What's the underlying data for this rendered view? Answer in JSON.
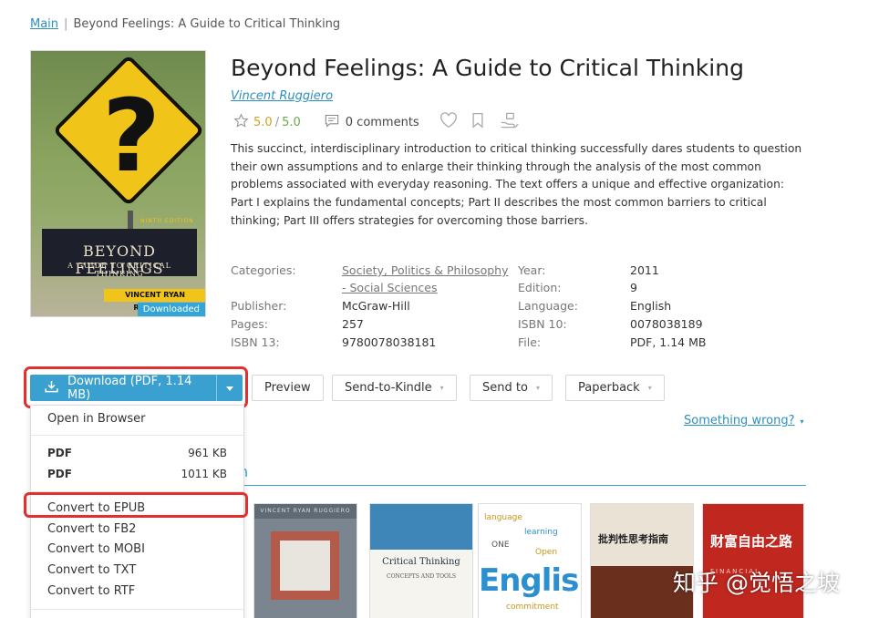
{
  "breadcrumb": {
    "home": "Main",
    "separator": "|",
    "current": "Beyond Feelings: A Guide to Critical Thinking"
  },
  "book": {
    "title": "Beyond Feelings: A Guide to Critical Thinking",
    "author": "Vincent Ruggiero",
    "rating": "5.0",
    "rating_separator": "/",
    "rating_max": "5.0",
    "comments": "0 comments",
    "description": "This succinct, interdisciplinary introduction to critical thinking successfully dares students to question their own assumptions and to enlarge their thinking through the analysis of the most common problems associated with everyday reasoning. The text offers a unique and effective organization: Part I explains the fundamental concepts; Part II describes the most common barriers to critical thinking; Part III offers strategies for overcoming those barriers.",
    "cover": {
      "edition_text": "NINTH EDITION",
      "title_line1": "BEYOND FEELINGS",
      "title_line2": "A GUIDE TO CRITICAL THINKING",
      "author_text": "VINCENT RYAN RUGGIERO",
      "downloaded_label": "Downloaded"
    }
  },
  "properties": {
    "categories_label": "Categories:",
    "categories_value_1": "Society, Politics & Philosophy",
    "categories_value_2": "- Social Sciences",
    "year_label": "Year:",
    "year_value": "2011",
    "edition_label": "Edition:",
    "edition_value": "9",
    "publisher_label": "Publisher:",
    "publisher_value": "McGraw-Hill",
    "language_label": "Language:",
    "language_value": "English",
    "pages_label": "Pages:",
    "pages_value": "257",
    "isbn10_label": "ISBN 10:",
    "isbn10_value": "0078038189",
    "isbn13_label": "ISBN 13:",
    "isbn13_value": "9780078038181",
    "file_label": "File:",
    "file_value": "PDF, 1.14 MB"
  },
  "actions": {
    "download": "Download (PDF, 1.14 MB)",
    "preview": "Preview",
    "send_to_kindle": "Send-to-Kindle",
    "send_to": "Send to",
    "paperback": "Paperback",
    "something_wrong": "Something wrong?"
  },
  "dropdown": {
    "open_in_browser": "Open in Browser",
    "formats": [
      {
        "format": "PDF",
        "size": "961 KB"
      },
      {
        "format": "PDF",
        "size": "1011 KB"
      }
    ],
    "convert": [
      "Convert to EPUB",
      "Convert to FB2",
      "Convert to MOBI",
      "Convert to TXT",
      "Convert to RTF"
    ]
  },
  "related": {
    "tab_fragment": "n",
    "thumbs": [
      {
        "header": "VINCENT RYAN RUGGIERO"
      },
      {
        "title": "Critical Thinking",
        "subtitle": "CONCEPTS AND TOOLS"
      },
      {
        "big": "English",
        "words": [
          "language",
          "learning",
          "ONE",
          "Open",
          "commitment"
        ]
      },
      {
        "title": "批判性思考指南"
      },
      {
        "title": "财富自由之路",
        "subtitle": "FINANCIAL"
      }
    ]
  },
  "watermark": "知乎 @觉悟之坡",
  "colors": {
    "accent": "#3aa0cf",
    "link": "#2a8fbd",
    "highlight_box": "#e03030",
    "rating": "#c9a227"
  }
}
